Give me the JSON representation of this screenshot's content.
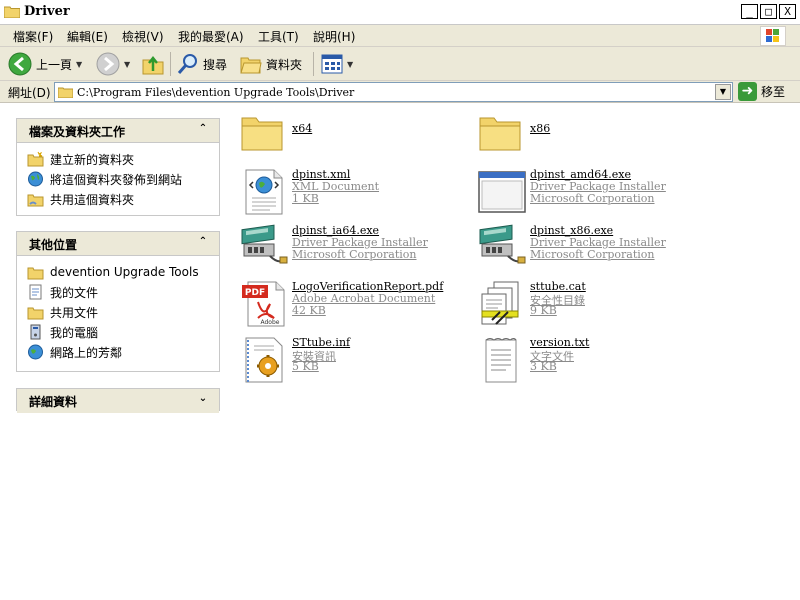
{
  "window": {
    "title": "Driver",
    "minimize": "_",
    "maximize": "□",
    "close": "X"
  },
  "menu": [
    "檔案(F)",
    "編輯(E)",
    "檢視(V)",
    "我的最愛(A)",
    "工具(T)",
    "說明(H)"
  ],
  "toolbar": {
    "back_label": "上一頁",
    "search_label": "搜尋",
    "folders_label": "資料夾"
  },
  "address": {
    "label": "網址(D)",
    "value": "C:\\Program Files\\devention Upgrade Tools\\Driver",
    "go_label": "移至"
  },
  "tasks_pane": {
    "title": "檔案及資料夾工作",
    "toggle": "⌃",
    "items": [
      "建立新的資料夾",
      "將這個資料夾發佈到網站",
      "共用這個資料夾"
    ]
  },
  "places_pane": {
    "title": "其他位置",
    "toggle": "⌃",
    "items": [
      "devention Upgrade Tools",
      "我的文件",
      "共用文件",
      "我的電腦",
      "網路上的芳鄰"
    ]
  },
  "details_pane": {
    "title": "詳細資料",
    "toggle": "⌄"
  },
  "files": [
    {
      "name": "x64",
      "type": "folder"
    },
    {
      "name": "x86",
      "type": "folder"
    },
    {
      "name": "dpinst.xml",
      "line1": "XML Document",
      "line2": "1 KB",
      "icon": "xml-document-icon"
    },
    {
      "name": "dpinst_amd64.exe",
      "line1": "Driver Package Installer",
      "line2": "Microsoft Corporation",
      "icon": "application-window-icon"
    },
    {
      "name": "dpinst_ia64.exe",
      "line1": "Driver Package Installer",
      "line2": "Microsoft Corporation",
      "icon": "driver-installer-icon"
    },
    {
      "name": "dpinst_x86.exe",
      "line1": "Driver Package Installer",
      "line2": "Microsoft Corporation",
      "icon": "driver-installer-icon"
    },
    {
      "name": "LogoVerificationReport.pdf",
      "line1": "Adobe Acrobat Document",
      "line2": "42 KB",
      "icon": "pdf-document-icon",
      "badge": "PDF",
      "brand": "Adobe"
    },
    {
      "name": "sttube.cat",
      "line1": "安全性目錄",
      "line2": "9 KB",
      "icon": "security-catalog-icon"
    },
    {
      "name": "STtube.inf",
      "line1": "安裝資訊",
      "line2": "5 KB",
      "icon": "setup-information-icon"
    },
    {
      "name": "version.txt",
      "line1": "文字文件",
      "line2": "3 KB",
      "icon": "text-document-icon"
    }
  ]
}
